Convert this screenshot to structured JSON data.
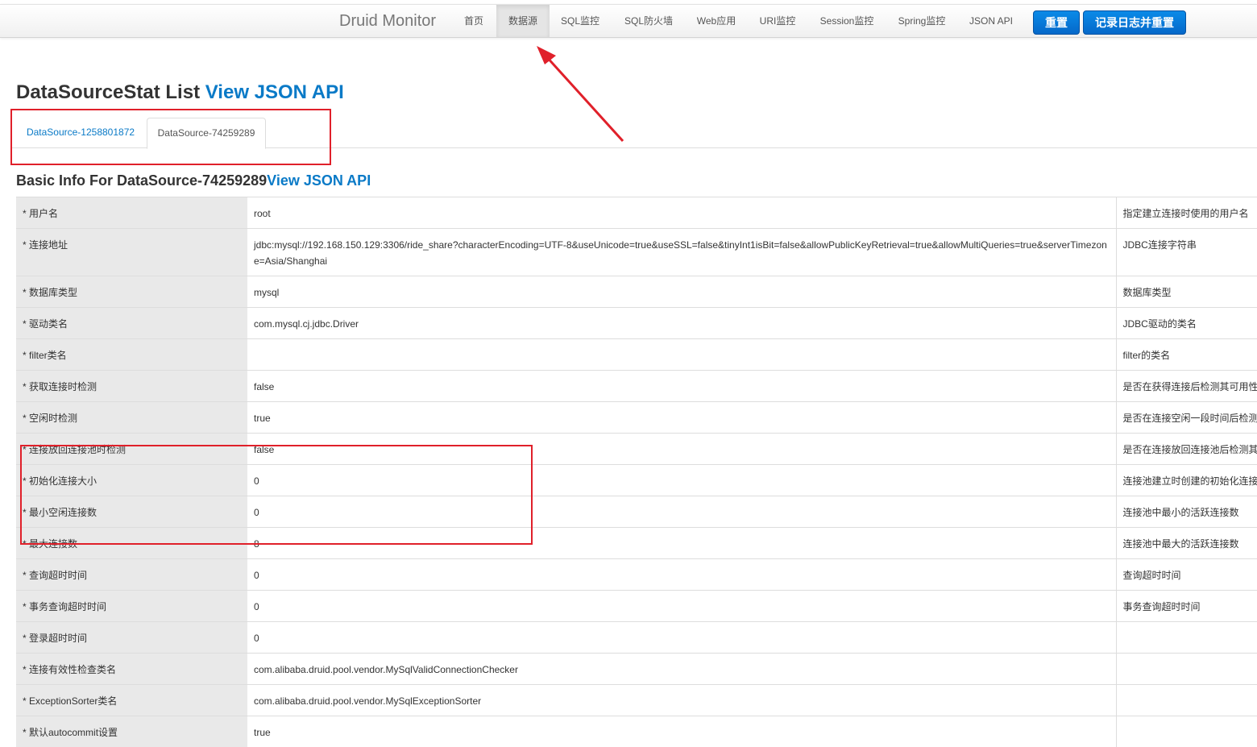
{
  "nav": {
    "brand": "Druid Monitor",
    "items": [
      "首页",
      "数据源",
      "SQL监控",
      "SQL防火墙",
      "Web应用",
      "URI监控",
      "Session监控",
      "Spring监控",
      "JSON API"
    ],
    "active_index": 1,
    "reset_button": "重置",
    "log_reset_button": "记录日志并重置"
  },
  "page": {
    "title": "DataSourceStat List",
    "title_link": "View JSON API"
  },
  "tabs": [
    "DataSource-1258801872",
    "DataSource-74259289"
  ],
  "active_tab_index": 1,
  "section": {
    "title": "Basic Info For DataSource-74259289",
    "title_link": "View JSON API"
  },
  "rows": [
    {
      "key": "* 用户名",
      "value": "root",
      "desc": "指定建立连接时使用的用户名"
    },
    {
      "key": "* 连接地址",
      "value": "jdbc:mysql://192.168.150.129:3306/ride_share?characterEncoding=UTF-8&useUnicode=true&useSSL=false&tinyInt1isBit=false&allowPublicKeyRetrieval=true&allowMultiQueries=true&serverTimezone=Asia/Shanghai",
      "desc": "JDBC连接字符串"
    },
    {
      "key": "* 数据库类型",
      "value": "mysql",
      "desc": "数据库类型"
    },
    {
      "key": "* 驱动类名",
      "value": "com.mysql.cj.jdbc.Driver",
      "desc": "JDBC驱动的类名"
    },
    {
      "key": "* filter类名",
      "value": "",
      "desc": "filter的类名"
    },
    {
      "key": "* 获取连接时检测",
      "value": "false",
      "desc": "是否在获得连接后检测其可用性"
    },
    {
      "key": "* 空闲时检测",
      "value": "true",
      "desc": "是否在连接空闲一段时间后检测其可用性"
    },
    {
      "key": "* 连接放回连接池时检测",
      "value": "false",
      "desc": "是否在连接放回连接池后检测其可用性"
    },
    {
      "key": "* 初始化连接大小",
      "value": "0",
      "desc": "连接池建立时创建的初始化连接数"
    },
    {
      "key": "* 最小空闲连接数",
      "value": "0",
      "desc": "连接池中最小的活跃连接数"
    },
    {
      "key": "* 最大连接数",
      "value": "8",
      "desc": "连接池中最大的活跃连接数"
    },
    {
      "key": "* 查询超时时间",
      "value": "0",
      "desc": "查询超时时间"
    },
    {
      "key": "* 事务查询超时时间",
      "value": "0",
      "desc": "事务查询超时时间"
    },
    {
      "key": "* 登录超时时间",
      "value": "0",
      "desc": ""
    },
    {
      "key": "* 连接有效性检查类名",
      "value": "com.alibaba.druid.pool.vendor.MySqlValidConnectionChecker",
      "desc": ""
    },
    {
      "key": "* ExceptionSorter类名",
      "value": "com.alibaba.druid.pool.vendor.MySqlExceptionSorter",
      "desc": ""
    },
    {
      "key": "* 默认autocommit设置",
      "value": "true",
      "desc": ""
    }
  ],
  "colors": {
    "link": "#0a7ac7",
    "button": "#0568c9",
    "annotation": "#e0202a",
    "key_column_bg": "#e9e9e9"
  }
}
